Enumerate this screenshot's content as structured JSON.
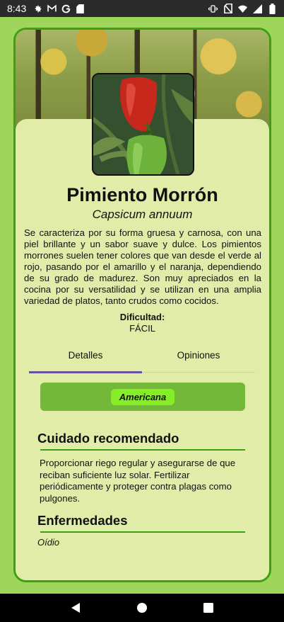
{
  "status_bar": {
    "time": "8:43",
    "left_icons": [
      "gear-icon",
      "mail-icon",
      "google-icon",
      "sd-card-icon"
    ],
    "right_icons": [
      "vibrate-icon",
      "no-sim-icon",
      "wifi-icon",
      "signal-icon",
      "battery-icon"
    ]
  },
  "plant": {
    "common_name": "Pimiento Morrón",
    "scientific_name": "Capsicum annuum",
    "description": "Se caracteriza por su forma gruesa y carnosa, con una piel brillante y un sabor suave y dulce. Los pimientos morrones suelen tener colores que van desde el verde al rojo, pasando por el amarillo y el naranja, dependiendo de su grado de madurez. Son muy apreciados en la cocina por su versatilidad y se utilizan en una amplia variedad de platos, tanto crudos como cocidos.",
    "difficulty_label": "Dificultad:",
    "difficulty_value": "FÁCIL"
  },
  "tabs": {
    "details": "Detalles",
    "reviews": "Opiniones",
    "active": "details"
  },
  "details": {
    "tag": "Americana",
    "care_title": "Cuidado recomendado",
    "care_text": "Proporcionar riego regular y asegurarse de que reciban suficiente luz solar. Fertilizar periódicamente y proteger contra plagas como pulgones.",
    "diseases_title": "Enfermedades",
    "diseases_text": "Oídio"
  },
  "colors": {
    "background": "#9ed55a",
    "card_border": "#3aa112",
    "card_fill": "#e0eca8",
    "tag_box": "#74b83a",
    "tag_chip": "#85ee24",
    "tab_indicator": "#6650a4"
  },
  "nav_bar": {
    "icons": [
      "back-icon",
      "home-icon",
      "recents-icon"
    ]
  }
}
